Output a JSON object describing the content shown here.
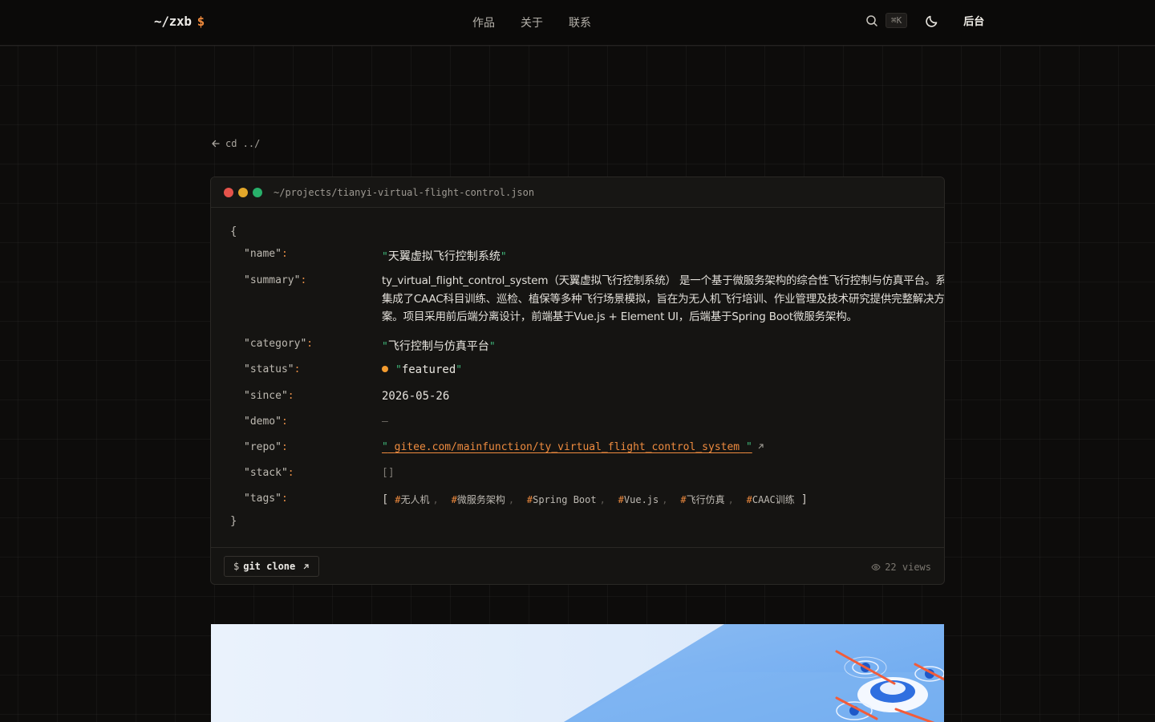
{
  "header": {
    "logo_text": "~/zxb",
    "logo_symbol": "$",
    "nav": [
      "作品",
      "关于",
      "联系"
    ],
    "shortcut": "⌘K",
    "admin_label": "后台"
  },
  "back_link": "cd ../",
  "card": {
    "path": "~/projects/tianyi-virtual-flight-control.json",
    "open_brace": "{",
    "close_brace": "}",
    "fields": {
      "name_key": "name",
      "name_value": "天翼虚拟飞行控制系统",
      "summary_key": "summary",
      "summary_value": "ty_virtual_flight_control_system（天翼虚拟飞行控制系统） 是一个基于微服务架构的综合性飞行控制与仿真平台。系统集成了CAAC科目训练、巡检、植保等多种飞行场景模拟，旨在为无人机飞行培训、作业管理及技术研究提供完整解决方案。项目采用前后端分离设计，前端基于Vue.js + Element UI，后端基于Spring Boot微服务架构。",
      "category_key": "category",
      "category_value": "飞行控制与仿真平台",
      "status_key": "status",
      "status_value": "featured",
      "since_key": "since",
      "since_value": "2026-05-26",
      "demo_key": "demo",
      "demo_value": "—",
      "repo_key": "repo",
      "repo_value": "gitee.com/mainfunction/ty_virtual_flight_control_system",
      "stack_key": "stack",
      "stack_value": "[]",
      "tags_key": "tags",
      "tags": [
        "无人机",
        "微服务架构",
        "Spring Boot",
        "Vue.js",
        "飞行仿真",
        "CAAC训练"
      ]
    },
    "footer": {
      "clone_prefix": "$",
      "clone_label": "git clone",
      "views": "22 views"
    }
  },
  "colors": {
    "accent": "#ef8a3e",
    "string_quote": "#3fb87a",
    "status_dot": "#f39b2f"
  },
  "icons": [
    "search-icon",
    "moon-icon",
    "arrow-left-icon",
    "external-link-icon",
    "eye-icon"
  ]
}
